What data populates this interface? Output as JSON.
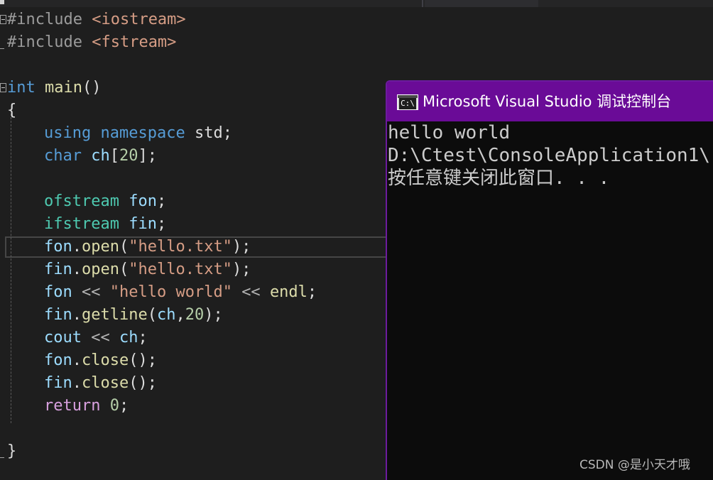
{
  "top_strip": {
    "active_tab": "partially-visible-tab"
  },
  "editor": {
    "lines": [
      [
        {
          "t": "#include ",
          "c": "pp"
        },
        {
          "t": "<iostream>",
          "c": "str"
        }
      ],
      [
        {
          "t": "#include ",
          "c": "pp"
        },
        {
          "t": "<fstream>",
          "c": "str"
        }
      ],
      [],
      [
        {
          "t": "int",
          "c": "kw"
        },
        {
          "t": " ",
          "c": "pl"
        },
        {
          "t": "main",
          "c": "fn"
        },
        {
          "t": "()",
          "c": "pl"
        }
      ],
      [
        {
          "t": "{",
          "c": "pl"
        }
      ],
      [
        {
          "t": "using",
          "c": "kw"
        },
        {
          "t": " ",
          "c": "pl"
        },
        {
          "t": "namespace",
          "c": "kw"
        },
        {
          "t": " ",
          "c": "pl"
        },
        {
          "t": "std",
          "c": "pl"
        },
        {
          "t": ";",
          "c": "pl"
        }
      ],
      [
        {
          "t": "char",
          "c": "kw"
        },
        {
          "t": " ",
          "c": "pl"
        },
        {
          "t": "ch",
          "c": "var"
        },
        {
          "t": "[",
          "c": "pl"
        },
        {
          "t": "20",
          "c": "num"
        },
        {
          "t": "];",
          "c": "pl"
        }
      ],
      [],
      [
        {
          "t": "ofstream",
          "c": "ty"
        },
        {
          "t": " ",
          "c": "pl"
        },
        {
          "t": "fon",
          "c": "var"
        },
        {
          "t": ";",
          "c": "pl"
        }
      ],
      [
        {
          "t": "ifstream",
          "c": "ty"
        },
        {
          "t": " ",
          "c": "pl"
        },
        {
          "t": "fin",
          "c": "var"
        },
        {
          "t": ";",
          "c": "pl"
        }
      ],
      [
        {
          "t": "fon",
          "c": "var"
        },
        {
          "t": ".",
          "c": "pl"
        },
        {
          "t": "open",
          "c": "fn"
        },
        {
          "t": "(",
          "c": "pl"
        },
        {
          "t": "\"hello.txt\"",
          "c": "str"
        },
        {
          "t": ");",
          "c": "pl"
        }
      ],
      [
        {
          "t": "fin",
          "c": "var"
        },
        {
          "t": ".",
          "c": "pl"
        },
        {
          "t": "open",
          "c": "fn"
        },
        {
          "t": "(",
          "c": "pl"
        },
        {
          "t": "\"hello.txt\"",
          "c": "str"
        },
        {
          "t": ");",
          "c": "pl"
        }
      ],
      [
        {
          "t": "fon",
          "c": "var"
        },
        {
          "t": " ",
          "c": "pl"
        },
        {
          "t": "<<",
          "c": "op"
        },
        {
          "t": " ",
          "c": "pl"
        },
        {
          "t": "\"hello world\"",
          "c": "str"
        },
        {
          "t": " ",
          "c": "pl"
        },
        {
          "t": "<<",
          "c": "op"
        },
        {
          "t": " ",
          "c": "pl"
        },
        {
          "t": "endl",
          "c": "fn"
        },
        {
          "t": ";",
          "c": "pl"
        }
      ],
      [
        {
          "t": "fin",
          "c": "var"
        },
        {
          "t": ".",
          "c": "pl"
        },
        {
          "t": "getline",
          "c": "fn"
        },
        {
          "t": "(",
          "c": "pl"
        },
        {
          "t": "ch",
          "c": "var"
        },
        {
          "t": ",",
          "c": "pl"
        },
        {
          "t": "20",
          "c": "num"
        },
        {
          "t": ");",
          "c": "pl"
        }
      ],
      [
        {
          "t": "cout",
          "c": "var"
        },
        {
          "t": " ",
          "c": "pl"
        },
        {
          "t": "<<",
          "c": "op"
        },
        {
          "t": " ",
          "c": "pl"
        },
        {
          "t": "ch",
          "c": "var"
        },
        {
          "t": ";",
          "c": "pl"
        }
      ],
      [
        {
          "t": "fon",
          "c": "var"
        },
        {
          "t": ".",
          "c": "pl"
        },
        {
          "t": "close",
          "c": "fn"
        },
        {
          "t": "();",
          "c": "pl"
        }
      ],
      [
        {
          "t": "fin",
          "c": "var"
        },
        {
          "t": ".",
          "c": "pl"
        },
        {
          "t": "close",
          "c": "fn"
        },
        {
          "t": "();",
          "c": "pl"
        }
      ],
      [
        {
          "t": "return",
          "c": "ctl"
        },
        {
          "t": " ",
          "c": "pl"
        },
        {
          "t": "0",
          "c": "num"
        },
        {
          "t": ";",
          "c": "pl"
        }
      ],
      [],
      [
        {
          "t": "}",
          "c": "pl"
        }
      ]
    ],
    "indent": [
      0,
      0,
      0,
      0,
      0,
      1,
      1,
      0,
      1,
      1,
      1,
      1,
      1,
      1,
      1,
      1,
      1,
      1,
      0,
      0
    ],
    "fold_lines": [
      0,
      3
    ],
    "current_line": 10,
    "colors": {
      "keyword": "#569cd6",
      "preprocessor": "#9b9b9b",
      "type": "#4ec9b0",
      "function": "#dcdcaa",
      "variable": "#9cdcfe",
      "string": "#d69d85",
      "number": "#b5cea8",
      "control": "#d8a0df"
    }
  },
  "console": {
    "title": "Microsoft Visual Studio 调试控制台",
    "icon_text": "C:\\",
    "icon": "console-app-icon",
    "lines": [
      "hello world",
      "D:\\Ctest\\ConsoleApplication1\\",
      "按任意键关闭此窗口. . ."
    ],
    "titlebar_color": "#6a0b97"
  },
  "watermark": "CSDN @是小天才哦"
}
